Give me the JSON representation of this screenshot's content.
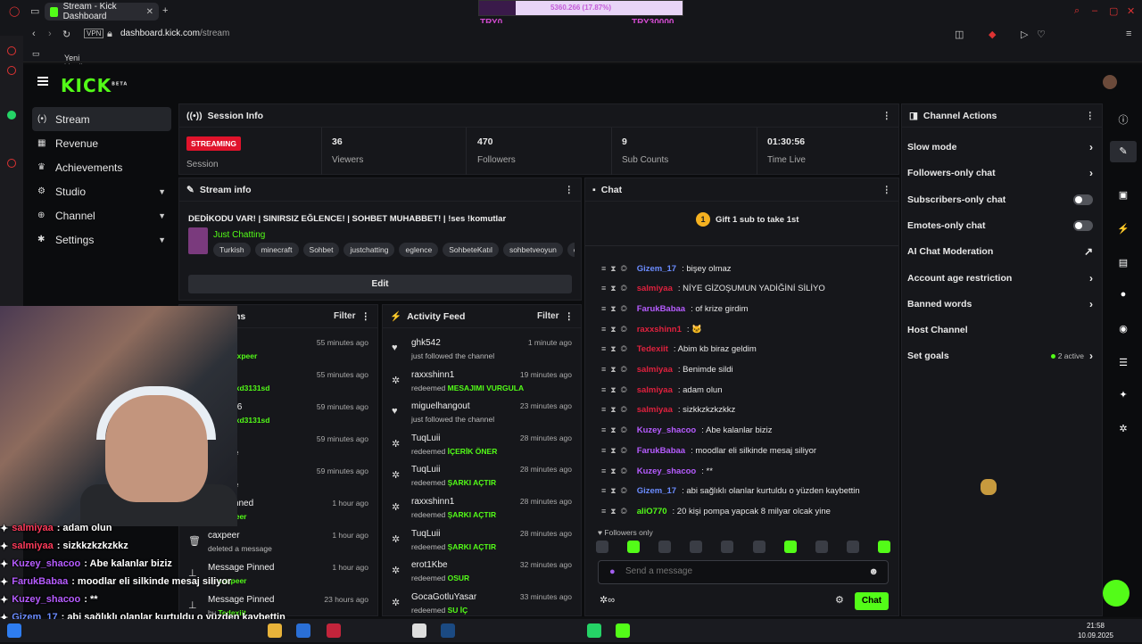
{
  "browser": {
    "tab_title": "Stream - Kick Dashboard",
    "url_domain": "dashboard.kick.com",
    "url_path": "/stream",
    "vpn_label": "VPN",
    "bookmark_folder": "Yeni klasör"
  },
  "overlay": {
    "goal_text": "5360.266 (17.87%)",
    "goal_progress": 0.1787,
    "left_label": "TRY0",
    "right_label": "TRY30000"
  },
  "brand": {
    "logo": "KICK",
    "logo_sup": "BETA"
  },
  "sidebar": {
    "items": [
      {
        "label": "Stream",
        "icon": "broadcast-icon"
      },
      {
        "label": "Revenue",
        "icon": "revenue-icon"
      },
      {
        "label": "Achievements",
        "icon": "trophy-icon"
      },
      {
        "label": "Studio",
        "icon": "studio-icon"
      },
      {
        "label": "Channel",
        "icon": "channel-icon"
      },
      {
        "label": "Settings",
        "icon": "gear-icon"
      }
    ]
  },
  "session_info": {
    "title": "Session Info",
    "status_badge": "STREAMING",
    "status_label": "Session",
    "stats": [
      {
        "value": "36",
        "label": "Viewers"
      },
      {
        "value": "470",
        "label": "Followers"
      },
      {
        "value": "9",
        "label": "Sub Counts"
      },
      {
        "value": "01:30:56",
        "label": "Time Live"
      }
    ]
  },
  "stream_info": {
    "title": "Stream info",
    "stream_title": "DEDİKODU VAR! | SINIRSIZ EĞLENCE! | SOHBET MUHABBET! | !ses !komutlar",
    "category": "Just Chatting",
    "tags": [
      "Turkish",
      "minecraft",
      "Sohbet",
      "justchatting",
      "eglence",
      "SohbeteKatıl",
      "sohbetveoyun",
      "caxp"
    ],
    "edit_label": "Edit"
  },
  "actions_panel": {
    "title_partial": "ns",
    "filter_label": "Filter",
    "rows": [
      {
        "name": "baa",
        "sub_prefix": "ed by",
        "sub_highlight": "caxpeer",
        "time": "55 minutes ago"
      },
      {
        "name": "baa",
        "sub_prefix": "by",
        "sub_highlight": "kaanxd3131sd",
        "time": "55 minutes ago"
      },
      {
        "name": "doJ1806",
        "sub_prefix": "by",
        "sub_highlight": "kaanxd3131sd",
        "time": "59 minutes ago"
      },
      {
        "name": "r",
        "sub_prefix": "message",
        "sub_highlight": "",
        "time": "59 minutes ago"
      },
      {
        "name": "r",
        "sub_prefix": "message",
        "sub_highlight": "",
        "time": "59 minutes ago"
      },
      {
        "name": "e Unpinned",
        "sub_prefix": "by",
        "sub_highlight": "caxpeer",
        "time": "1 hour ago"
      },
      {
        "name": "caxpeer",
        "sub_prefix": "deleted a message",
        "sub_highlight": "",
        "time": "1 hour ago"
      },
      {
        "name": "Message Pinned",
        "sub_prefix": "by",
        "sub_highlight": "caxpeer",
        "time": "1 hour ago"
      },
      {
        "name": "Message Pinned",
        "sub_prefix": "by",
        "sub_highlight": "Tedexiit",
        "time": "23 hours ago"
      }
    ]
  },
  "activity_feed": {
    "title": "Activity Feed",
    "filter_label": "Filter",
    "rows": [
      {
        "name": "ghk542",
        "sub_prefix": "just followed the channel",
        "sub_highlight": "",
        "time": "1 minute ago",
        "kind": "follow"
      },
      {
        "name": "raxxshinn1",
        "sub_prefix": "redeemed",
        "sub_highlight": "MESAJIMI VURGULA",
        "time": "19 minutes ago",
        "kind": "redeem"
      },
      {
        "name": "miguelhangout",
        "sub_prefix": "just followed the channel",
        "sub_highlight": "",
        "time": "23 minutes ago",
        "kind": "follow"
      },
      {
        "name": "TuqLuii",
        "sub_prefix": "redeemed",
        "sub_highlight": "İÇERİK ÖNER",
        "time": "28 minutes ago",
        "kind": "redeem"
      },
      {
        "name": "TuqLuii",
        "sub_prefix": "redeemed",
        "sub_highlight": "ŞARKI AÇTIR",
        "time": "28 minutes ago",
        "kind": "redeem"
      },
      {
        "name": "raxxshinn1",
        "sub_prefix": "redeemed",
        "sub_highlight": "ŞARKI AÇTIR",
        "time": "28 minutes ago",
        "kind": "redeem"
      },
      {
        "name": "TuqLuii",
        "sub_prefix": "redeemed",
        "sub_highlight": "ŞARKI AÇTIR",
        "time": "28 minutes ago",
        "kind": "redeem"
      },
      {
        "name": "erot1Kbe",
        "sub_prefix": "redeemed",
        "sub_highlight": "OSUR",
        "time": "32 minutes ago",
        "kind": "redeem"
      },
      {
        "name": "GocaGotluYasar",
        "sub_prefix": "redeemed",
        "sub_highlight": "SU İÇ",
        "time": "33 minutes ago",
        "kind": "redeem"
      }
    ]
  },
  "chat": {
    "title": "Chat",
    "gift_text": "Gift 1 sub to take 1st",
    "gift_count": "1",
    "messages": [
      {
        "user": "Gizem_17",
        "color": "#6b8cff",
        "text": "bişey olmaz"
      },
      {
        "user": "salmiyaa",
        "color": "#e0213e",
        "text": "NİYE GİZOŞUMUN YADİĞİNİ SİLİYO"
      },
      {
        "user": "FarukBabaa",
        "color": "#b65cff",
        "text": "of krize girdim"
      },
      {
        "user": "raxxshinn1",
        "color": "#e0213e",
        "text": "🐱"
      },
      {
        "user": "Tedexiit",
        "color": "#e0213e",
        "text": "Abim kb biraz geldim"
      },
      {
        "user": "salmiyaa",
        "color": "#e0213e",
        "text": "Benimde sildi"
      },
      {
        "user": "salmiyaa",
        "color": "#e0213e",
        "text": "adam olun"
      },
      {
        "user": "salmiyaa",
        "color": "#e0213e",
        "text": "sizkkzkzkzkkz"
      },
      {
        "user": "Kuzey_shacoo",
        "color": "#b65cff",
        "text": "Abe kalanlar biziz"
      },
      {
        "user": "FarukBabaa",
        "color": "#b65cff",
        "text": "moodlar eli silkinde mesaj siliyor"
      },
      {
        "user": "Kuzey_shacoo",
        "color": "#b65cff",
        "text": "**"
      },
      {
        "user": "Gizem_17",
        "color": "#6b8cff",
        "text": "abi sağlıklı olanlar kurtuldu o yüzden kaybettin"
      },
      {
        "user": "aliO770",
        "color": "#53fc18",
        "text": "20 kişi pompa yapcak 8 milyar olcak yine"
      }
    ],
    "followers_only": "Followers only",
    "input_placeholder": "Send a message",
    "send_label": "Chat"
  },
  "channel_actions": {
    "title": "Channel Actions",
    "items": [
      {
        "label": "Slow mode",
        "control": "chevron"
      },
      {
        "label": "Followers-only chat",
        "control": "chevron"
      },
      {
        "label": "Subscribers-only chat",
        "control": "toggle"
      },
      {
        "label": "Emotes-only chat",
        "control": "toggle"
      },
      {
        "label": "AI Chat Moderation",
        "control": "external"
      },
      {
        "label": "Account age restriction",
        "control": "chevron"
      },
      {
        "label": "Banned words",
        "control": "chevron"
      },
      {
        "label": "Host Channel",
        "control": "none"
      },
      {
        "label": "Set goals",
        "control": "chevron",
        "extra": "2 active"
      }
    ]
  },
  "overlay_chat": [
    {
      "user": "salmiyaa",
      "color": "#ff3b5b",
      "text": ": adam olun"
    },
    {
      "user": "salmiyaa",
      "color": "#ff3b5b",
      "text": ": sizkkzkzkzkkz"
    },
    {
      "user": "Kuzey_shacoo",
      "color": "#b65cff",
      "text": ": Abe kalanlar biziz"
    },
    {
      "user": "FarukBabaa",
      "color": "#b65cff",
      "text": ": moodlar eli silkinde mesaj siliyor"
    },
    {
      "user": "Kuzey_shacoo",
      "color": "#b65cff",
      "text": ": **"
    },
    {
      "user": "Gizem_17",
      "color": "#6b8cff",
      "text": ": abi sağlıklı olanlar kurtuldu o yüzden kaybettin"
    },
    {
      "user": "aliO770",
      "color": "#53fc18",
      "text": ": 20 kişi pompa yapcak 8 milyar olcak yine"
    }
  ],
  "taskbar": {
    "time": "21:58",
    "date": "10.09.2025"
  }
}
